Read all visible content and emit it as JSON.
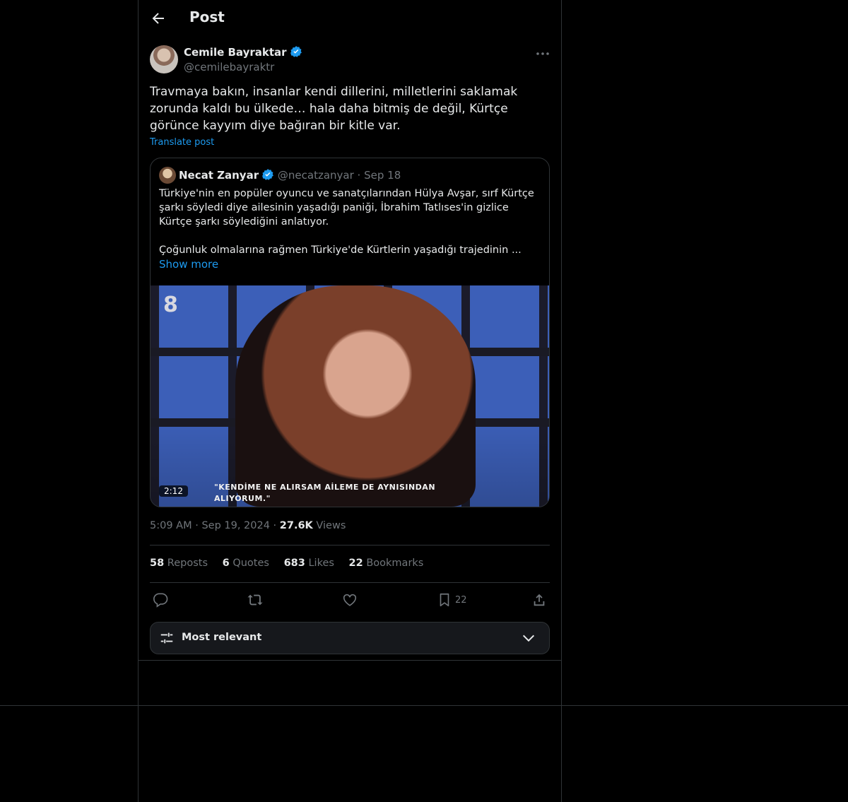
{
  "header": {
    "title": "Post"
  },
  "author": {
    "name": "Cemile Bayraktar",
    "handle": "@cemilebayraktr"
  },
  "tweet": {
    "text": "Travmaya bakın, insanlar kendi dillerini, milletlerini saklamak zorunda kaldı bu ülkede… hala daha bitmiş de değil, Kürtçe görünce kayyım diye bağıran bir kitle var.",
    "translate_label": "Translate post",
    "time": "5:09 AM",
    "date": "Sep 19, 2024",
    "views_count": "27.6K",
    "views_label": "Views"
  },
  "quote": {
    "name": "Necat Zanyar",
    "handle": "@necatzanyar",
    "separator": "·",
    "date": "Sep 18",
    "text_p1": "Türkiye'nin en popüler oyuncu ve sanatçılarından Hülya Avşar, sırf Kürtçe şarkı söyledi diye ailesinin yaşadığı paniği, İbrahim Tatlıses'in gizlice Kürtçe şarkı söylediğini anlatıyor.",
    "text_p2": "Çoğunluk olmalarına rağmen Türkiye'de Kürtlerin yaşadığı trajedinin ...",
    "show_more": "Show more",
    "video": {
      "duration": "2:12",
      "caption_line1": "\"KENDİME NE ALIRSAM AİLEME DE AYNISINDAN",
      "caption_line2": "ALIYORUM.\"",
      "channel_logo": "8"
    }
  },
  "stats": {
    "reposts_count": "58",
    "reposts_label": "Reposts",
    "quotes_count": "6",
    "quotes_label": "Quotes",
    "likes_count": "683",
    "likes_label": "Likes",
    "bookmarks_count": "22",
    "bookmarks_label": "Bookmarks"
  },
  "actions": {
    "icons": [
      "reply-icon",
      "repost-icon",
      "like-icon",
      "bookmark-icon",
      "share-icon"
    ],
    "bookmark_count": "22"
  },
  "sort": {
    "label": "Most relevant"
  },
  "colors": {
    "accent": "#1d9bf0",
    "text": "#e7e9ea",
    "muted": "#71767b",
    "border": "#2f3336",
    "background": "#000000"
  }
}
